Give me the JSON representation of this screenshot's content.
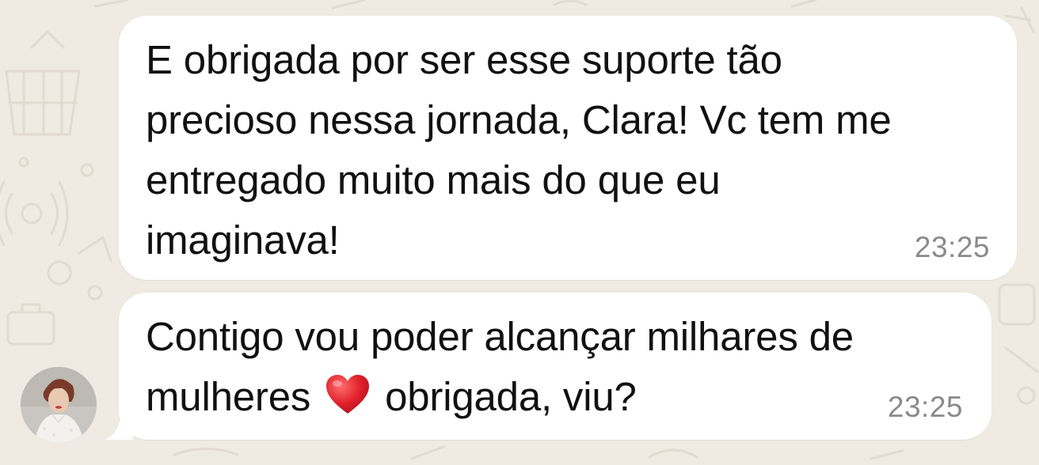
{
  "chat": {
    "messages": [
      {
        "text_before": "E obrigada por ser esse suporte tão\nprecioso nessa jornada, Clara! Vc tem me\nentregado muito mais do que eu\nimaginava!",
        "time": "23:25"
      },
      {
        "text_before": "Contigo vou poder alcançar milhares de\nmulheres ",
        "emoji": "heart-icon",
        "text_after": " obrigada, viu?",
        "time": "23:25"
      }
    ]
  },
  "colors": {
    "background": "#efeae2",
    "bubble": "#ffffff",
    "text": "#111111",
    "timestamp": "#8a8a8a",
    "heart": "#e0202c"
  }
}
